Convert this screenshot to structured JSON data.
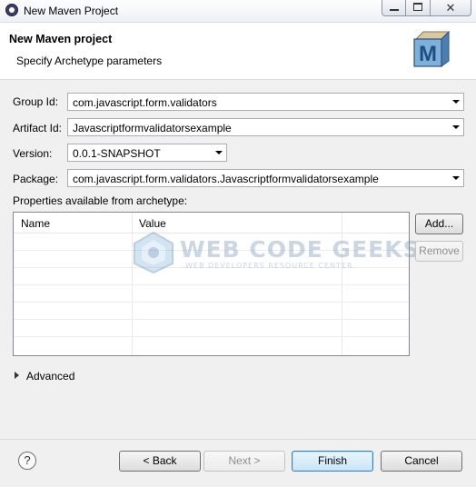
{
  "window": {
    "title": "New Maven Project"
  },
  "header": {
    "title": "New Maven project",
    "subtitle": "Specify Archetype parameters",
    "logo_letter": "M"
  },
  "form": {
    "group_id": {
      "label": "Group Id:",
      "value": "com.javascript.form.validators"
    },
    "artifact_id": {
      "label": "Artifact Id:",
      "value": "Javascriptformvalidatorsexample"
    },
    "version": {
      "label": "Version:",
      "value": "0.0.1-SNAPSHOT"
    },
    "package": {
      "label": "Package:",
      "value": "com.javascript.form.validators.Javascriptformvalidatorsexample"
    }
  },
  "properties": {
    "label": "Properties available from archetype:",
    "columns": [
      "Name",
      "Value"
    ],
    "add_label": "Add...",
    "remove_label": "Remove"
  },
  "advanced": {
    "label": "Advanced"
  },
  "footer": {
    "help": "?",
    "back_label": "< Back",
    "next_label": "Next >",
    "finish_label": "Finish",
    "cancel_label": "Cancel"
  },
  "watermark": {
    "title": "WEB CODE GEEKS",
    "subtitle": "WEB DEVELOPERS RESOURCE CENTER"
  }
}
